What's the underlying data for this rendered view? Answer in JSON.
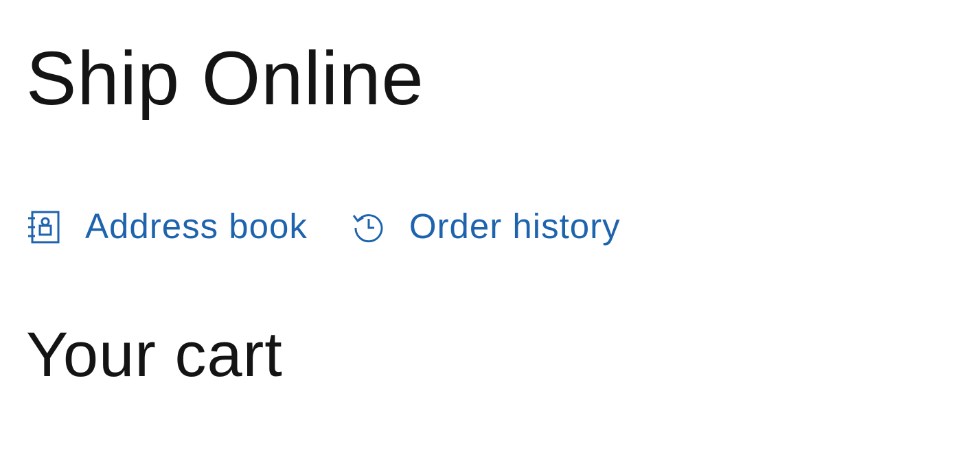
{
  "page": {
    "title": "Ship Online"
  },
  "quick_links": {
    "address_book": {
      "label": "Address book",
      "icon": "address-book-icon"
    },
    "order_history": {
      "label": "Order history",
      "icon": "history-icon"
    }
  },
  "cart": {
    "title": "Your cart"
  },
  "colors": {
    "link": "#1d63ad",
    "text": "#141414",
    "background": "#ffffff"
  }
}
